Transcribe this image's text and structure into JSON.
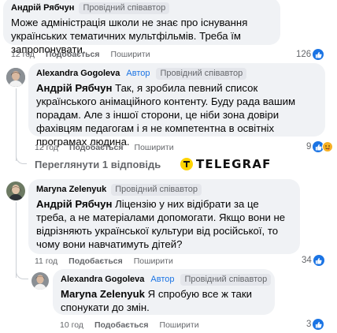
{
  "comments": [
    {
      "author": "Андрій Рябчун",
      "badge": "Провідний співавтор",
      "text": "Може адміністрація школи не знає про існування українських тематичних мультфільмів. Треба їм запропонувати.",
      "time": "12 год",
      "like": "Подобається",
      "share": "Поширити",
      "reactions": "126",
      "reaction_icons": [
        "like-icon"
      ]
    },
    {
      "author": "Alexandra Gogoleva",
      "author_label": "Автор",
      "badge": "Провідний співавтор",
      "mention": "Андрій Рябчун",
      "text": " Так, я зробила певний список українського анімаційного контенту. Буду рада вашим порадам. Але з іншої сторони, це ніби зона довіри фахівцям педагогам і я не компетентна в освітніх програмах людина.",
      "time": "12 год",
      "like": "Подобається",
      "share": "Поширити",
      "reactions": "9",
      "reaction_icons": [
        "like-icon",
        "care-icon"
      ]
    },
    {
      "author": "Maryna Zelenyuk",
      "badge": "Провідний співавтор",
      "mention": "Андрій Рябчун",
      "text": " Ліцензію у них відібрати за це треба, а не матеріалами допомогати. Якщо вони не відрізняють української культури від російської, то чому вони навчатимуть дітей?",
      "time": "11 год",
      "like": "Подобається",
      "share": "Поширити",
      "reactions": "34",
      "reaction_icons": [
        "like-icon"
      ]
    },
    {
      "author": "Alexandra Gogoleva",
      "author_label": "Автор",
      "badge": "Провідний співавтор",
      "mention": "Maryna Zelenyuk",
      "text": " Я спробую все ж таки спонукати до змін.",
      "time": "10 год",
      "like": "Подобається",
      "share": "Поширити",
      "reactions": "3",
      "reaction_icons": [
        "like-icon"
      ]
    }
  ],
  "view_replies": "Переглянути 1 відповідь",
  "watermark": "TELEGRAF",
  "colors": {
    "bubble": "#f0f2f5",
    "accent": "#1b74e4",
    "meta": "#65676b",
    "watermark_logo": "#ffd400"
  }
}
